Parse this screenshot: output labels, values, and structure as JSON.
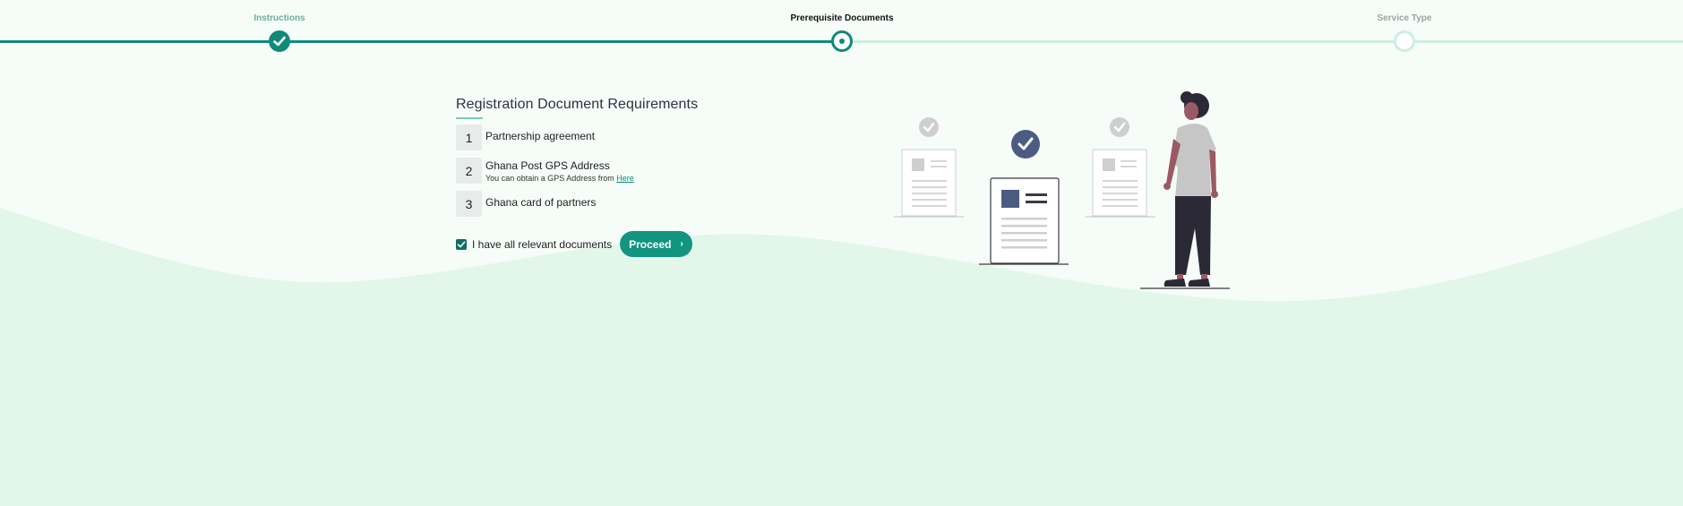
{
  "stepper": {
    "steps": [
      {
        "label": "Instructions",
        "state": "done"
      },
      {
        "label": "Prerequisite Documents",
        "state": "current"
      },
      {
        "label": "Service Type",
        "state": "todo"
      }
    ]
  },
  "requirements": {
    "title": "Registration Document Requirements",
    "items": [
      {
        "number": "1",
        "label": "Partnership agreement"
      },
      {
        "number": "2",
        "label": "Ghana Post GPS Address",
        "note": "You can obtain a GPS Address from",
        "link_text": "Here"
      },
      {
        "number": "3",
        "label": "Ghana card of partners"
      }
    ]
  },
  "confirm": {
    "checkbox_label": "I have all relevant documents",
    "checked": true
  },
  "proceed_button": {
    "label": "Proceed",
    "icon": "chevron-right-icon"
  },
  "colors": {
    "primary": "#119580",
    "primary_dark": "#0f8a78",
    "track_inactive": "#cdeee2",
    "background_top": "#f6fcf8",
    "background_wave": "#e2f7ea",
    "illustration_accent": "#4b5b82"
  }
}
